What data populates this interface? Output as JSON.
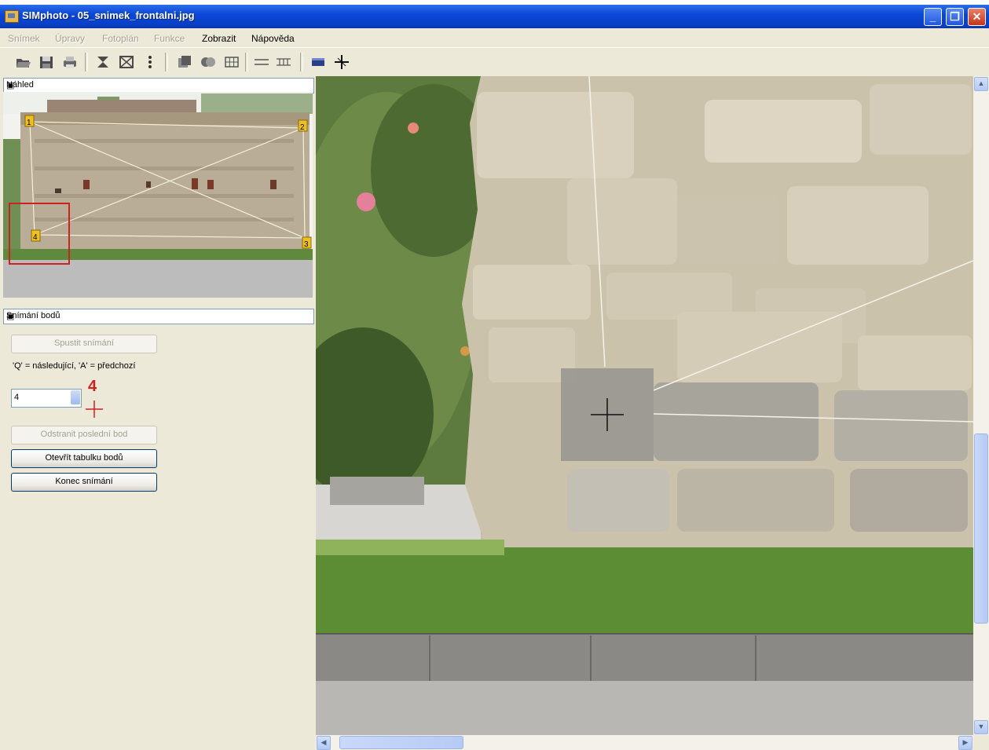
{
  "window": {
    "title": "SIMphoto - 05_snimek_frontalni.jpg",
    "controls": {
      "minimize": "_",
      "maximize": "❐",
      "close": "✕"
    }
  },
  "menu": [
    {
      "label": "Snímek",
      "enabled": false
    },
    {
      "label": "Úpravy",
      "enabled": false
    },
    {
      "label": "Fotoplán",
      "enabled": false
    },
    {
      "label": "Funkce",
      "enabled": false
    },
    {
      "label": "Zobrazit",
      "enabled": true
    },
    {
      "label": "Nápověda",
      "enabled": true
    }
  ],
  "toolbar_icons": [
    "open-icon",
    "save-icon",
    "print-icon",
    "crop-icon",
    "transform-icon",
    "points-icon",
    "layer-icon",
    "merge-icon",
    "grid-icon",
    "align-icon",
    "measure-icon",
    "image-view-icon",
    "crosshair-icon"
  ],
  "preview_panel": {
    "title": "Náhled",
    "point_labels": [
      "1",
      "2",
      "3",
      "4"
    ]
  },
  "capture_panel": {
    "title": "Snímání bodů",
    "start_button": "Spustit snímání",
    "hint": "'Q' = následující, 'A' = předchozí",
    "point_number_value": "4",
    "current_point_number": "4",
    "remove_last_button": "Odstranit poslední bod",
    "open_table_button": "Otevřít tabulku bodů",
    "end_button": "Konec snímání"
  },
  "scroll": {
    "up": "▲",
    "down": "▼",
    "left": "◀",
    "right": "▶"
  }
}
